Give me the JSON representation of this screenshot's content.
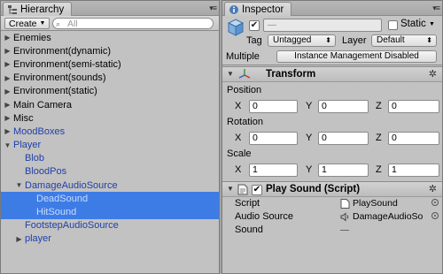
{
  "hierarchy": {
    "tab_title": "Hierarchy",
    "create_label": "Create",
    "search_placeholder": "All",
    "items": [
      {
        "label": "Enemies",
        "indent": 0,
        "fold": "collapsed",
        "prefab": false,
        "selected": false
      },
      {
        "label": "Environment(dynamic)",
        "indent": 0,
        "fold": "collapsed",
        "prefab": false,
        "selected": false
      },
      {
        "label": "Environment(semi-static)",
        "indent": 0,
        "fold": "collapsed",
        "prefab": false,
        "selected": false
      },
      {
        "label": "Environment(sounds)",
        "indent": 0,
        "fold": "collapsed",
        "prefab": false,
        "selected": false
      },
      {
        "label": "Environment(static)",
        "indent": 0,
        "fold": "collapsed",
        "prefab": false,
        "selected": false
      },
      {
        "label": "Main Camera",
        "indent": 0,
        "fold": "collapsed",
        "prefab": false,
        "selected": false
      },
      {
        "label": "Misc",
        "indent": 0,
        "fold": "collapsed",
        "prefab": false,
        "selected": false
      },
      {
        "label": "MoodBoxes",
        "indent": 0,
        "fold": "collapsed",
        "prefab": true,
        "selected": false
      },
      {
        "label": "Player",
        "indent": 0,
        "fold": "expanded",
        "prefab": true,
        "selected": false
      },
      {
        "label": "Blob",
        "indent": 1,
        "fold": "none",
        "prefab": true,
        "selected": false
      },
      {
        "label": "BloodPos",
        "indent": 1,
        "fold": "none",
        "prefab": true,
        "selected": false
      },
      {
        "label": "DamageAudioSource",
        "indent": 1,
        "fold": "expanded",
        "prefab": true,
        "selected": false
      },
      {
        "label": "DeadSound",
        "indent": 2,
        "fold": "none",
        "prefab": true,
        "selected": true
      },
      {
        "label": "HitSound",
        "indent": 2,
        "fold": "none",
        "prefab": true,
        "selected": true
      },
      {
        "label": "FootstepAudioSource",
        "indent": 1,
        "fold": "none",
        "prefab": true,
        "selected": false
      },
      {
        "label": "player",
        "indent": 1,
        "fold": "collapsed",
        "prefab": true,
        "selected": false
      }
    ]
  },
  "inspector": {
    "tab_title": "Inspector",
    "name_value": "—",
    "active_checked": true,
    "static_label": "Static",
    "tag_label": "Tag",
    "tag_value": "Untagged",
    "layer_label": "Layer",
    "layer_value": "Default",
    "multiple_label": "Multiple",
    "multiple_button": "Instance Management Disabled",
    "transform": {
      "title": "Transform",
      "position_label": "Position",
      "rotation_label": "Rotation",
      "scale_label": "Scale",
      "axes": [
        "X",
        "Y",
        "Z"
      ],
      "position": [
        "0",
        "0",
        "0"
      ],
      "rotation": [
        "0",
        "0",
        "0"
      ],
      "scale": [
        "1",
        "1",
        "1"
      ]
    },
    "play_sound": {
      "title": "Play Sound (Script)",
      "enabled": true,
      "script_label": "Script",
      "script_value": "PlaySound",
      "audio_source_label": "Audio Source",
      "audio_source_value": "DamageAudioSo",
      "sound_label": "Sound",
      "sound_value": "—"
    }
  },
  "colors": {
    "selection": "#3e7ce5",
    "prefab_text": "#1f3fa8",
    "panel_bg": "#c2c2c2"
  }
}
